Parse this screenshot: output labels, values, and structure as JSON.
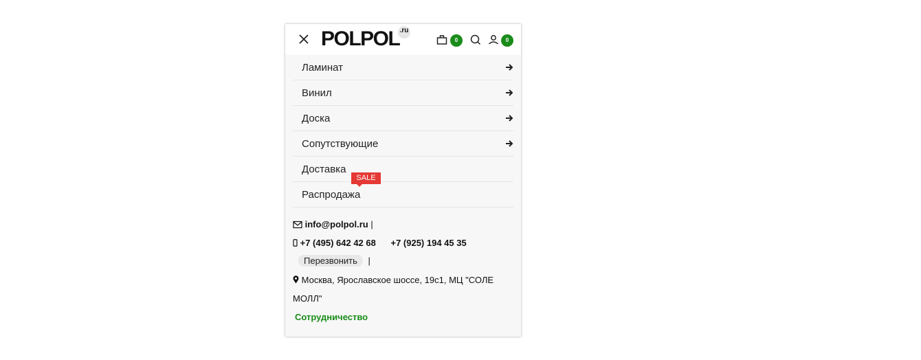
{
  "header": {
    "logo_text": "POLPOL",
    "logo_suffix": ".ru",
    "cart_count": "0",
    "account_count": "0"
  },
  "menu": {
    "items": [
      {
        "label": "Ламинат",
        "has_arrow": true
      },
      {
        "label": "Винил",
        "has_arrow": true
      },
      {
        "label": "Доска",
        "has_arrow": true
      },
      {
        "label": "Сопутствующие",
        "has_arrow": true
      },
      {
        "label": "Доставка",
        "has_arrow": false
      },
      {
        "label": "Распродажа",
        "has_arrow": false
      }
    ],
    "sale_badge": "SALE"
  },
  "contacts": {
    "email": "info@polpol.ru",
    "email_separator": "|",
    "phone1": "+7 (495) 642 42 68",
    "phone2": "+7 (925) 194 45 35",
    "callback_label": "Перезвонить",
    "callback_separator": "|",
    "address_line1": "Москва, Ярославское шоссе, 19с1, МЦ \"СОЛЕ",
    "address_line2": "МОЛЛ\"",
    "cooperation_link": "Сотрудничество"
  },
  "colors": {
    "accent_green": "#1a8c1a",
    "sale_red": "#e53935"
  }
}
